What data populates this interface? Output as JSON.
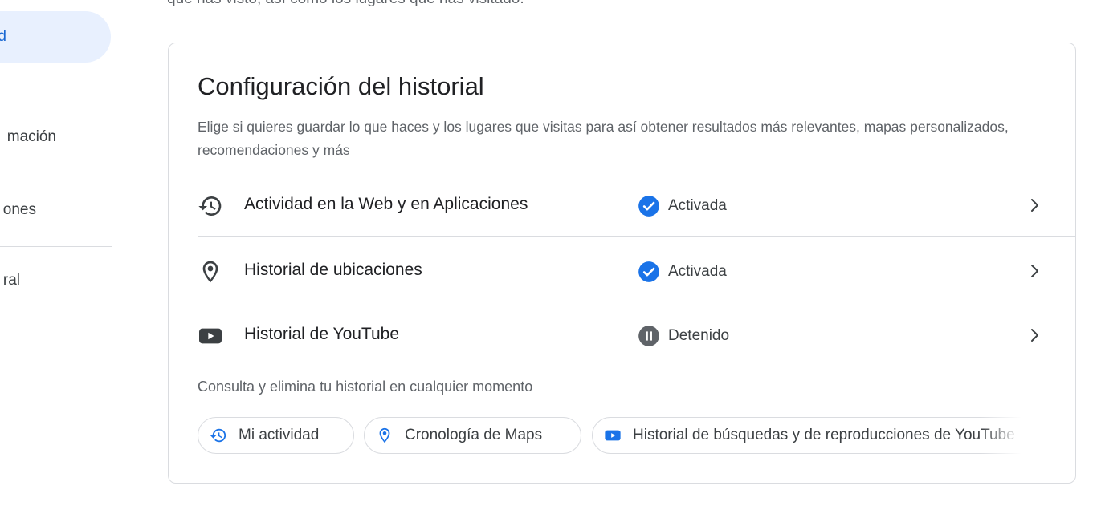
{
  "sidebar": {
    "items": [
      {
        "label": "d"
      },
      {
        "label": "mación"
      },
      {
        "label": "ones"
      },
      {
        "label": "ral"
      }
    ]
  },
  "intro": {
    "text": "que has visto, así como los lugares que has visitado."
  },
  "card": {
    "title": "Configuración del historial",
    "description": "Elige si quieres guardar lo que haces y los lugares que visitas para así obtener resultados más relevantes, mapas personalizados, recomendaciones y más",
    "settings": [
      {
        "label": "Actividad en la Web y en Aplicaciones",
        "status": "Activada",
        "icon": "history-icon",
        "status_icon": "check-circle-icon"
      },
      {
        "label": "Historial de ubicaciones",
        "status": "Activada",
        "icon": "location-pin-icon",
        "status_icon": "check-circle-icon"
      },
      {
        "label": "Historial de YouTube",
        "status": "Detenido",
        "icon": "youtube-icon",
        "status_icon": "pause-circle-icon"
      }
    ],
    "consult_text": "Consulta y elimina tu historial en cualquier momento",
    "chips": [
      {
        "label": "Mi actividad",
        "icon": "history-icon"
      },
      {
        "label": "Cronología de Maps",
        "icon": "location-pin-icon"
      },
      {
        "label": "Historial de búsquedas y de reproducciones de YouTube",
        "icon": "youtube-icon"
      }
    ]
  },
  "colors": {
    "accent": "#1a73e8",
    "active_nav_bg": "#e8f0fe",
    "active_nav_text": "#1967d2",
    "paused": "#5f6368",
    "divider": "#dadce0"
  }
}
